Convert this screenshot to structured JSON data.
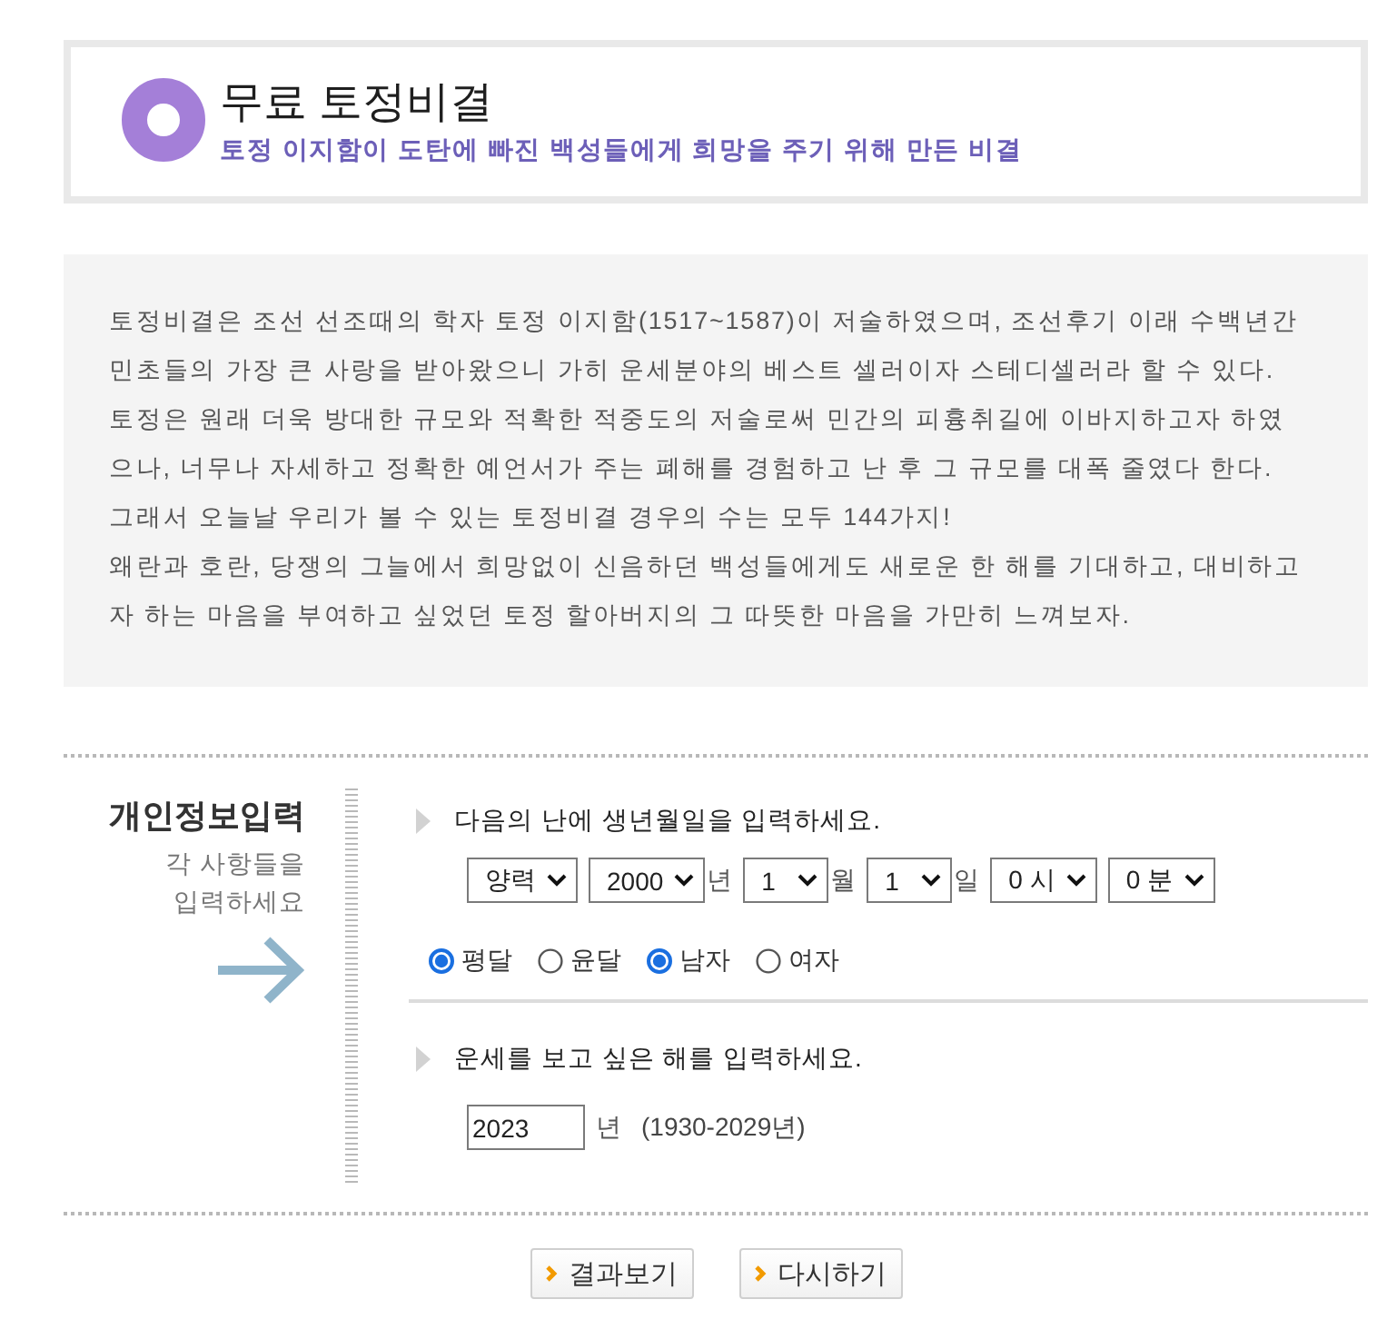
{
  "header": {
    "title": "무료 토정비결",
    "subtitle": "토정 이지함이 도탄에 빠진 백성들에게 희망을 주기 위해 만든 비결"
  },
  "description": {
    "paragraphs": [
      "토정비결은 조선 선조때의 학자 토정 이지함(1517~1587)이 저술하였으며, 조선후기 이래 수백년간 민초들의 가장 큰 사랑을 받아왔으니 가히 운세분야의 베스트 셀러이자 스테디셀러라 할 수 있다. 토정은 원래 더욱 방대한 규모와 적확한 적중도의 저술로써 민간의 피흉취길에 이바지하고자 하였으나, 너무나 자세하고 정확한 예언서가 주는 폐해를 경험하고 난 후 그 규모를 대폭 줄였다 한다. 그래서 오늘날 우리가 볼 수 있는 토정비결 경우의 수는 모두 144가지!",
      "왜란과 호란, 당쟁의 그늘에서 희망없이 신음하던 백성들에게도 새로운 한 해를 기대하고, 대비하고자 하는 마음을 부여하고 싶었던 토정 할아버지의 그 따뜻한 마음을 가만히 느껴보자."
    ]
  },
  "form": {
    "heading": "개인정보입력",
    "hint": [
      "각 사항들을",
      "입력하세요"
    ],
    "birth": {
      "prompt": "다음의 난에 생년월일을 입력하세요.",
      "selects": [
        {
          "value": "양력"
        },
        {
          "value": "2000",
          "unit": "년"
        },
        {
          "value": "1",
          "unit": "월"
        },
        {
          "value": "1",
          "unit": "일"
        },
        {
          "value": "0 시"
        },
        {
          "value": "0 분"
        }
      ],
      "radio_groups": [
        {
          "options": [
            {
              "label": "평달",
              "selected": true
            },
            {
              "label": "윤달",
              "selected": false
            }
          ]
        },
        {
          "options": [
            {
              "label": "남자",
              "selected": true
            },
            {
              "label": "여자",
              "selected": false
            }
          ]
        }
      ]
    },
    "target_year": {
      "prompt": "운세를 보고 싶은 해를 입력하세요.",
      "value": "2023",
      "unit": "년",
      "range": "(1930-2029년)"
    }
  },
  "buttons": [
    "결과보기",
    "다시하기"
  ]
}
